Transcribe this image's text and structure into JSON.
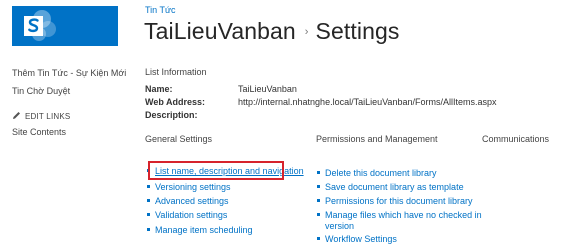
{
  "colors": {
    "brand": "#0072c6",
    "highlight": "#d6232c"
  },
  "logo": {
    "icon": "sharepoint-logo-icon"
  },
  "breadcrumb": {
    "site_link": "Tin Tức"
  },
  "header": {
    "library_name": "TaiLieuVanban",
    "separator": "›",
    "page_name": "Settings"
  },
  "leftnav": {
    "items": [
      "Thêm Tin Tức - Sự Kiện Mới",
      "Tin Chờ Duyệt"
    ],
    "edit_links": "EDIT LINKS",
    "edit_icon": "pencil-icon",
    "site_contents": "Site Contents"
  },
  "list_info": {
    "heading": "List Information",
    "rows": [
      {
        "label": "Name:",
        "value": "TaiLieuVanban"
      },
      {
        "label": "Web Address:",
        "value": "http://internal.nhatnghe.local/TaiLieuVanban/Forms/AllItems.aspx"
      },
      {
        "label": "Description:",
        "value": ""
      }
    ]
  },
  "sections": {
    "general": {
      "title": "General Settings",
      "links": [
        "List name, description and navigation",
        "Versioning settings",
        "Advanced settings",
        "Validation settings",
        "Manage item scheduling"
      ]
    },
    "permissions": {
      "title": "Permissions and Management",
      "links": [
        "Delete this document library",
        "Save document library as template",
        "Permissions for this document library",
        "Manage files which have no checked in",
        "version",
        "Workflow Settings"
      ]
    },
    "communications": {
      "title": "Communications"
    }
  }
}
